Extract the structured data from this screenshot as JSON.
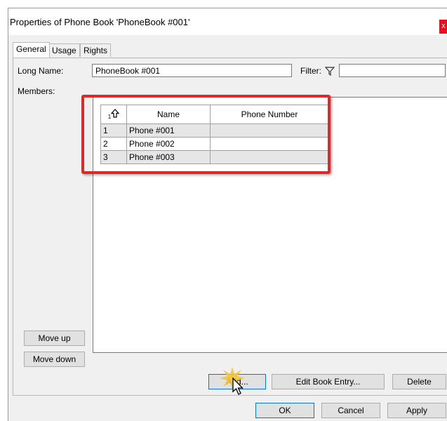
{
  "window": {
    "title": "Properties of Phone Book 'PhoneBook #001'",
    "close_glyph": "x"
  },
  "tabs": [
    {
      "label": "General",
      "active": true
    },
    {
      "label": "Usage",
      "active": false
    },
    {
      "label": "Rights",
      "active": false
    }
  ],
  "form": {
    "long_name_label": "Long Name:",
    "long_name_value": "PhoneBook #001",
    "filter_label": "Filter:",
    "filter_value": "",
    "members_label": "Members:"
  },
  "members_table": {
    "sort_indicator": "1",
    "columns": [
      "",
      "Name",
      "Phone Number"
    ],
    "rows": [
      {
        "index": "1",
        "name": "Phone #001",
        "phone": ""
      },
      {
        "index": "2",
        "name": "Phone #002",
        "phone": ""
      },
      {
        "index": "3",
        "name": "Phone #003",
        "phone": ""
      }
    ]
  },
  "side_buttons": {
    "move_up": "Move up",
    "move_down": "Move down"
  },
  "list_buttons": {
    "add": "Add...",
    "edit": "Edit Book Entry...",
    "delete": "Delete"
  },
  "dialog_buttons": {
    "ok": "OK",
    "cancel": "Cancel",
    "apply": "Apply"
  },
  "colors": {
    "highlight": "#e02828",
    "close": "#e81123",
    "focus": "#0078d7"
  },
  "icons": {
    "filter": "funnel-icon",
    "sort": "sort-up-arrow-icon",
    "cursor": "mouse-pointer-icon"
  }
}
